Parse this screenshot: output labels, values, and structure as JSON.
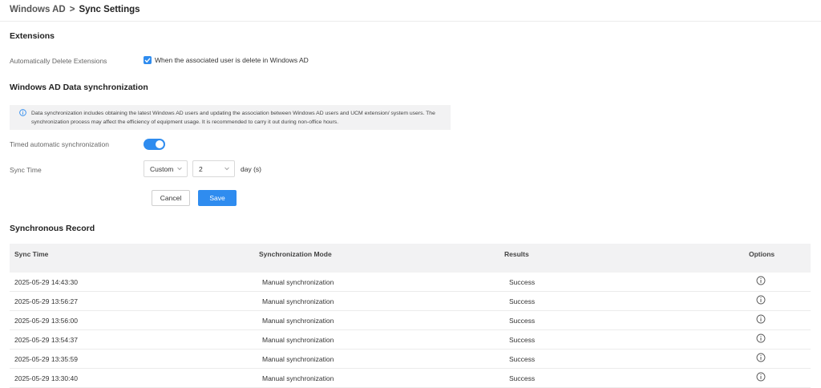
{
  "breadcrumb": {
    "parent": "Windows AD",
    "separator": ">",
    "current": "Sync Settings"
  },
  "extensions": {
    "title": "Extensions",
    "auto_delete_label": "Automatically Delete Extensions",
    "auto_delete_checked": true,
    "auto_delete_text": "When the associated user is delete in Windows AD"
  },
  "sync": {
    "title": "Windows AD Data synchronization",
    "notice": "Data synchronization includes obtaining the latest Windows AD users and updating the association between Windows AD users and UCM extension/ system users. The synchronization process may affect the efficiency of equipment usage. It is recommended to carry it out during non-office hours.",
    "timed_label": "Timed automatic synchronization",
    "timed_enabled": true,
    "sync_time_label": "Sync Time",
    "mode_value": "Custom",
    "interval_value": "2",
    "interval_unit": "day (s)",
    "cancel_label": "Cancel",
    "save_label": "Save"
  },
  "records": {
    "title": "Synchronous Record",
    "columns": [
      "Sync Time",
      "Synchronization Mode",
      "Results",
      "Options"
    ],
    "rows": [
      {
        "time": "2025-05-29 14:43:30",
        "mode": "Manual synchronization",
        "result": "Success"
      },
      {
        "time": "2025-05-29 13:56:27",
        "mode": "Manual synchronization",
        "result": "Success"
      },
      {
        "time": "2025-05-29 13:56:00",
        "mode": "Manual synchronization",
        "result": "Success"
      },
      {
        "time": "2025-05-29 13:54:37",
        "mode": "Manual synchronization",
        "result": "Success"
      },
      {
        "time": "2025-05-29 13:35:59",
        "mode": "Manual synchronization",
        "result": "Success"
      },
      {
        "time": "2025-05-29 13:30:40",
        "mode": "Manual synchronization",
        "result": "Success"
      }
    ],
    "option_icon": "info-circle-icon"
  },
  "colors": {
    "accent": "#2f8cef",
    "notice_bg": "#f2f2f3",
    "header_bg": "#f2f2f3"
  }
}
